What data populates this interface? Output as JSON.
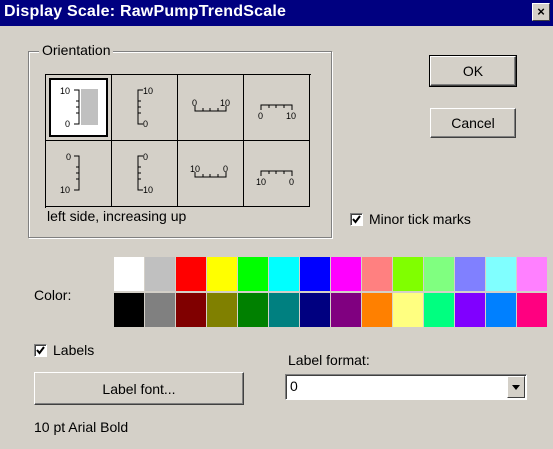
{
  "window": {
    "title": "Display Scale: RawPumpTrendScale",
    "close_glyph": "×"
  },
  "orientation": {
    "group_label": "Orientation",
    "selected_index": 0,
    "description": "left side, increasing up",
    "cells": [
      {
        "icon": "scale-left-increasing-up-icon",
        "labels": [
          "10",
          "0"
        ]
      },
      {
        "icon": "scale-right-increasing-up-icon",
        "labels": [
          "10",
          "0"
        ]
      },
      {
        "icon": "scale-bottom-increasing-right-icon",
        "labels": [
          "0",
          "10"
        ]
      },
      {
        "icon": "scale-top-increasing-right-icon",
        "labels": [
          "0",
          "10"
        ]
      },
      {
        "icon": "scale-left-increasing-down-icon",
        "labels": [
          "0",
          "10"
        ]
      },
      {
        "icon": "scale-right-increasing-down-icon",
        "labels": [
          "0",
          "10"
        ]
      },
      {
        "icon": "scale-bottom-increasing-left-icon",
        "labels": [
          "10",
          "0"
        ]
      },
      {
        "icon": "scale-top-increasing-left-icon",
        "labels": [
          "10",
          "0"
        ]
      }
    ]
  },
  "buttons": {
    "ok": "OK",
    "cancel": "Cancel",
    "label_font": "Label font..."
  },
  "minor_ticks": {
    "label": "Minor tick marks",
    "checked": true
  },
  "color": {
    "label": "Color:",
    "row1": [
      "#ffffff",
      "#c0c0c0",
      "#ff0000",
      "#ffff00",
      "#00ff00",
      "#00ffff",
      "#0000ff",
      "#ff00ff",
      "#ff8080",
      "#80ff00",
      "#80ff80",
      "#8080ff",
      "#80ffff",
      "#ff80ff"
    ],
    "row2": [
      "#000000",
      "#808080",
      "#800000",
      "#808000",
      "#008000",
      "#008080",
      "#000080",
      "#800080",
      "#ff8000",
      "#ffff80",
      "#00ff80",
      "#8000ff",
      "#0080ff",
      "#ff0080"
    ]
  },
  "labels_option": {
    "label": "Labels",
    "checked": true
  },
  "label_format": {
    "label": "Label format:",
    "value": "0"
  },
  "font_description": "10 pt Arial Bold"
}
